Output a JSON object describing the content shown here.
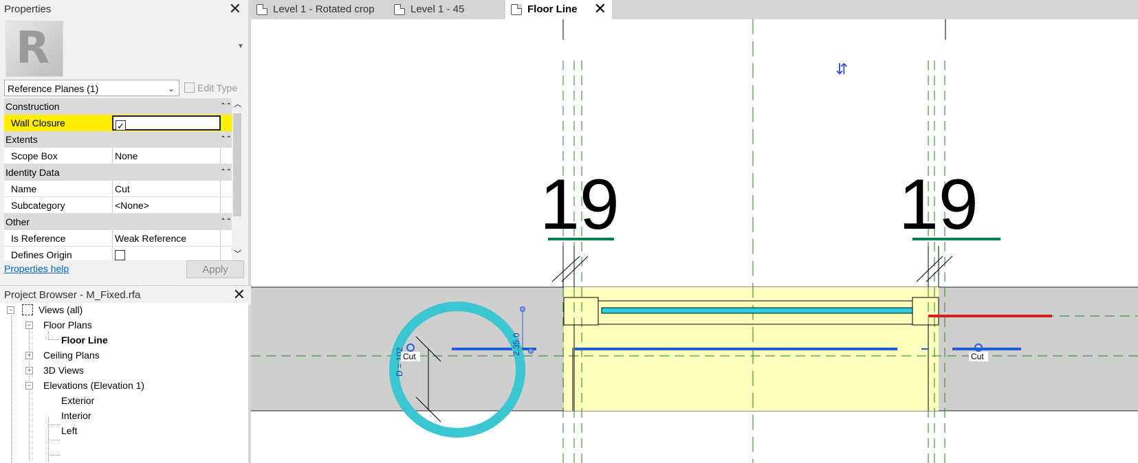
{
  "properties": {
    "title": "Properties",
    "type_selector": "Reference Planes (1)",
    "edit_type": "Edit Type",
    "help_link": "Properties help",
    "apply": "Apply",
    "groups": {
      "construction": "Construction",
      "extents": "Extents",
      "identity": "Identity Data",
      "other": "Other"
    },
    "rows": {
      "wall_closure": {
        "label": "Wall Closure",
        "checked": true
      },
      "scope_box": {
        "label": "Scope Box",
        "value": "None"
      },
      "name": {
        "label": "Name",
        "value": "Cut"
      },
      "subcategory": {
        "label": "Subcategory",
        "value": "<None>"
      },
      "is_reference": {
        "label": "Is Reference",
        "value": "Weak Reference"
      },
      "defines_origin": {
        "label": "Defines Origin",
        "checked": false
      }
    },
    "highlight_color": "#ffee00"
  },
  "project_browser": {
    "title": "Project Browser - M_Fixed.rfa",
    "items": {
      "views": "Views (all)",
      "floor_plans": "Floor Plans",
      "floor_line": "Floor Line",
      "ceiling_plans": "Ceiling Plans",
      "views3d": "3D Views",
      "elevations": "Elevations (Elevation 1)",
      "exterior": "Exterior",
      "interior": "Interior",
      "left": "Left"
    }
  },
  "tabs": {
    "t1": "Level 1 - Rotated crop",
    "t2": "Level 1 - 45",
    "t3": "Floor Line"
  },
  "canvas": {
    "number_left": "19",
    "number_right": "19",
    "cut_label": "Cut",
    "dim_d": "D = 102",
    "dim_w": "2.35.0",
    "colors": {
      "ref_line": "#1a8a1a",
      "blue_line": "#1e5fd6",
      "cyan_circle": "#3cc6d2",
      "yellow_fill": "#ffffbe",
      "gray_band": "#cfcfcf",
      "red_line": "#d62020"
    }
  }
}
